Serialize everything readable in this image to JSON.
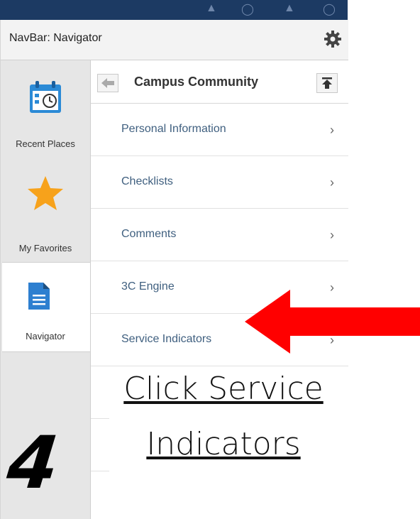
{
  "panel": {
    "title": "NavBar: Navigator",
    "settings_icon": "gear-icon"
  },
  "side_nav": [
    {
      "label": "Recent Places",
      "icon": "calendar-clock-icon"
    },
    {
      "label": "My Favorites",
      "icon": "star-icon"
    },
    {
      "label": "Navigator",
      "icon": "document-icon"
    }
  ],
  "breadcrumb": {
    "title": "Campus Community",
    "back_icon": "back-arrow-icon",
    "top_icon": "scroll-top-icon"
  },
  "menu": [
    {
      "label": "Personal Information"
    },
    {
      "label": "Checklists"
    },
    {
      "label": "Comments"
    },
    {
      "label": "3C Engine"
    },
    {
      "label": "Service Indicators"
    }
  ],
  "chevron": "›",
  "annotation": {
    "step": "4",
    "line1": "Click Service",
    "line2": "Indicators",
    "arrow_color": "#ff0000"
  },
  "colors": {
    "menu_text": "#3f5f7f",
    "favorite_star": "#f7a21b",
    "navigator_doc": "#2d7fd0",
    "recent_cal": "#2b8ad6"
  }
}
